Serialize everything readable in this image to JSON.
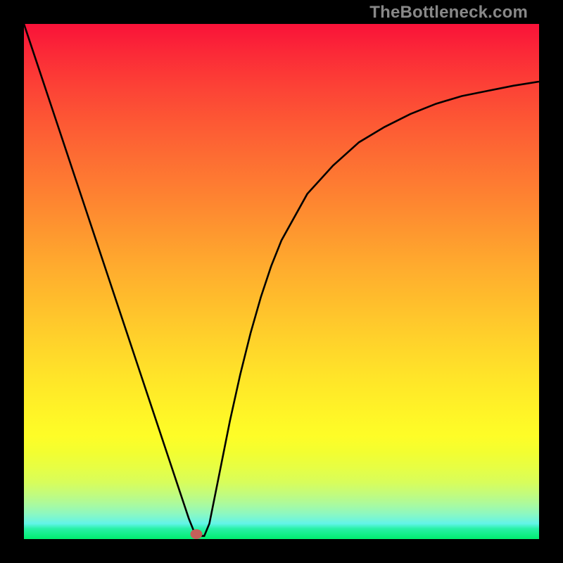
{
  "watermark": "TheBottleneck.com",
  "marker": {
    "x_pct": 33.5,
    "y_pct": 99.0
  },
  "chart_data": {
    "type": "line",
    "title": "",
    "xlabel": "",
    "ylabel": "",
    "xlim": [
      0,
      100
    ],
    "ylim": [
      0,
      100
    ],
    "background_gradient": {
      "orientation": "vertical",
      "top_color": "#fa1239",
      "bottom_color": "#00ee6f",
      "note": "worst (red) at top to best (green) at bottom"
    },
    "series": [
      {
        "name": "bottleneck-curve",
        "x": [
          0,
          2,
          4,
          6,
          8,
          10,
          12,
          14,
          16,
          18,
          20,
          22,
          24,
          26,
          28,
          30,
          31,
          32,
          33,
          34,
          35,
          36,
          38,
          40,
          42,
          44,
          46,
          48,
          50,
          55,
          60,
          65,
          70,
          75,
          80,
          85,
          90,
          95,
          100
        ],
        "y": [
          100,
          94,
          88,
          82,
          76,
          70,
          64,
          58,
          52,
          46,
          40,
          34,
          28,
          22,
          16,
          10,
          7,
          4,
          1.5,
          0.6,
          0.6,
          3,
          13,
          23,
          32,
          40,
          47,
          53,
          58,
          67,
          72.5,
          77,
          80,
          82.5,
          84.5,
          86,
          87,
          88,
          88.8
        ]
      }
    ],
    "marker_point": {
      "x": 33.5,
      "y": 0.8,
      "color": "#c4605a"
    },
    "colors": {
      "curve": "#000000",
      "frame": "#000000"
    }
  }
}
